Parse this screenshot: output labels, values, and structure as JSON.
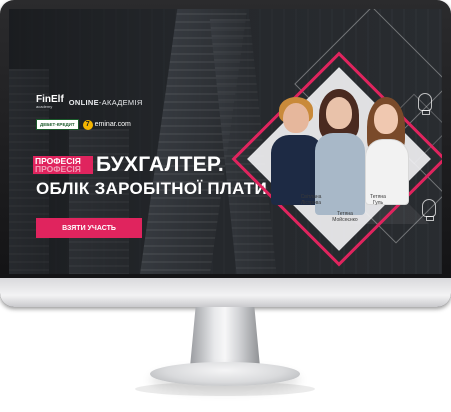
{
  "academy": {
    "brand": "FinElf",
    "brand_sub": "academy",
    "label_bold": "ONLINE",
    "label_rest": "-АКАДЕМІЯ"
  },
  "partners": {
    "dk_label": "ДЕБЕТ-КРЕДИТ",
    "seminar_digit": "7",
    "seminar_label": "eminar.com"
  },
  "hero": {
    "profession_tag": "ПРОФЕСІЯ",
    "profession_tag_echo": "ПРОФЕСІЯ",
    "title_line1": "БУХГАЛТЕР.",
    "title_line2": "ОБЛІК ЗАРОБІТНОЇ ПЛАТИ",
    "cta_label": "ВЗЯТИ УЧАСТЬ"
  },
  "speakers": [
    {
      "first": "Світлана",
      "last": "Лістрова"
    },
    {
      "first": "Тетяна",
      "last": "Мойсеєнко"
    },
    {
      "first": "Тетяна",
      "last": "Гуль"
    }
  ],
  "colors": {
    "accent": "#e0245e",
    "background": "#1f2225"
  }
}
